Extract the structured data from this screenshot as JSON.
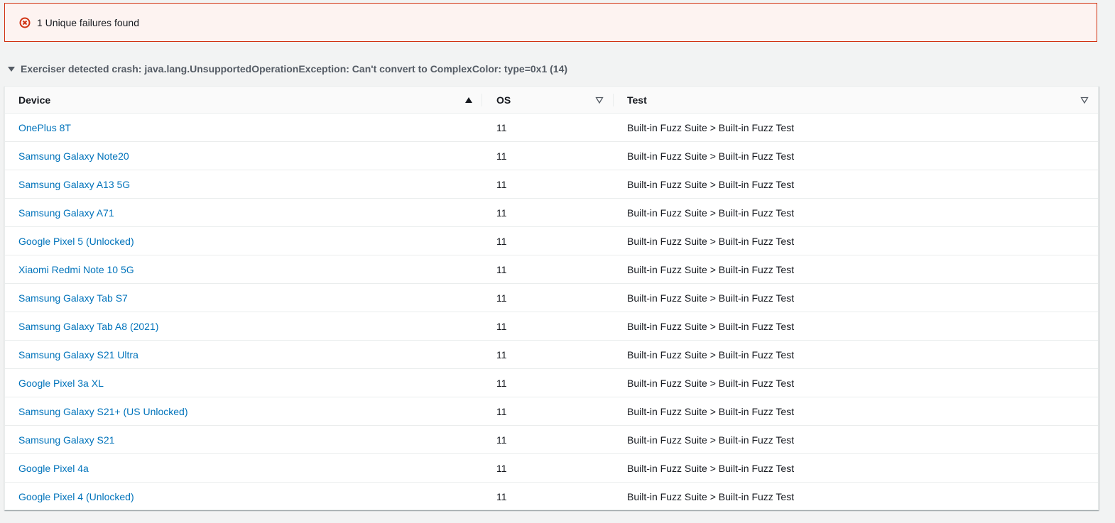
{
  "alert": {
    "icon": "error-circle-icon",
    "text": "1 Unique failures found",
    "color": "#d13212"
  },
  "section": {
    "title": "Exerciser detected crash: java.lang.UnsupportedOperationException: Can't convert to ComplexColor: type=0x1 (14)"
  },
  "table": {
    "columns": [
      {
        "label": "Device",
        "sort": "ascending"
      },
      {
        "label": "OS",
        "sort": "none"
      },
      {
        "label": "Test",
        "sort": "none"
      }
    ],
    "rows": [
      {
        "device": "OnePlus 8T",
        "os": "11",
        "test": "Built-in Fuzz Suite > Built-in Fuzz Test"
      },
      {
        "device": "Samsung Galaxy Note20",
        "os": "11",
        "test": "Built-in Fuzz Suite > Built-in Fuzz Test"
      },
      {
        "device": "Samsung Galaxy A13 5G",
        "os": "11",
        "test": "Built-in Fuzz Suite > Built-in Fuzz Test"
      },
      {
        "device": "Samsung Galaxy A71",
        "os": "11",
        "test": "Built-in Fuzz Suite > Built-in Fuzz Test"
      },
      {
        "device": "Google Pixel 5 (Unlocked)",
        "os": "11",
        "test": "Built-in Fuzz Suite > Built-in Fuzz Test"
      },
      {
        "device": "Xiaomi Redmi Note 10 5G",
        "os": "11",
        "test": "Built-in Fuzz Suite > Built-in Fuzz Test"
      },
      {
        "device": "Samsung Galaxy Tab S7",
        "os": "11",
        "test": "Built-in Fuzz Suite > Built-in Fuzz Test"
      },
      {
        "device": "Samsung Galaxy Tab A8 (2021)",
        "os": "11",
        "test": "Built-in Fuzz Suite > Built-in Fuzz Test"
      },
      {
        "device": "Samsung Galaxy S21 Ultra",
        "os": "11",
        "test": "Built-in Fuzz Suite > Built-in Fuzz Test"
      },
      {
        "device": "Google Pixel 3a XL",
        "os": "11",
        "test": "Built-in Fuzz Suite > Built-in Fuzz Test"
      },
      {
        "device": "Samsung Galaxy S21+ (US Unlocked)",
        "os": "11",
        "test": "Built-in Fuzz Suite > Built-in Fuzz Test"
      },
      {
        "device": "Samsung Galaxy S21",
        "os": "11",
        "test": "Built-in Fuzz Suite > Built-in Fuzz Test"
      },
      {
        "device": "Google Pixel 4a",
        "os": "11",
        "test": "Built-in Fuzz Suite > Built-in Fuzz Test"
      },
      {
        "device": "Google Pixel 4 (Unlocked)",
        "os": "11",
        "test": "Built-in Fuzz Suite > Built-in Fuzz Test"
      }
    ]
  },
  "colors": {
    "link": "#0073bb",
    "error": "#d13212"
  }
}
